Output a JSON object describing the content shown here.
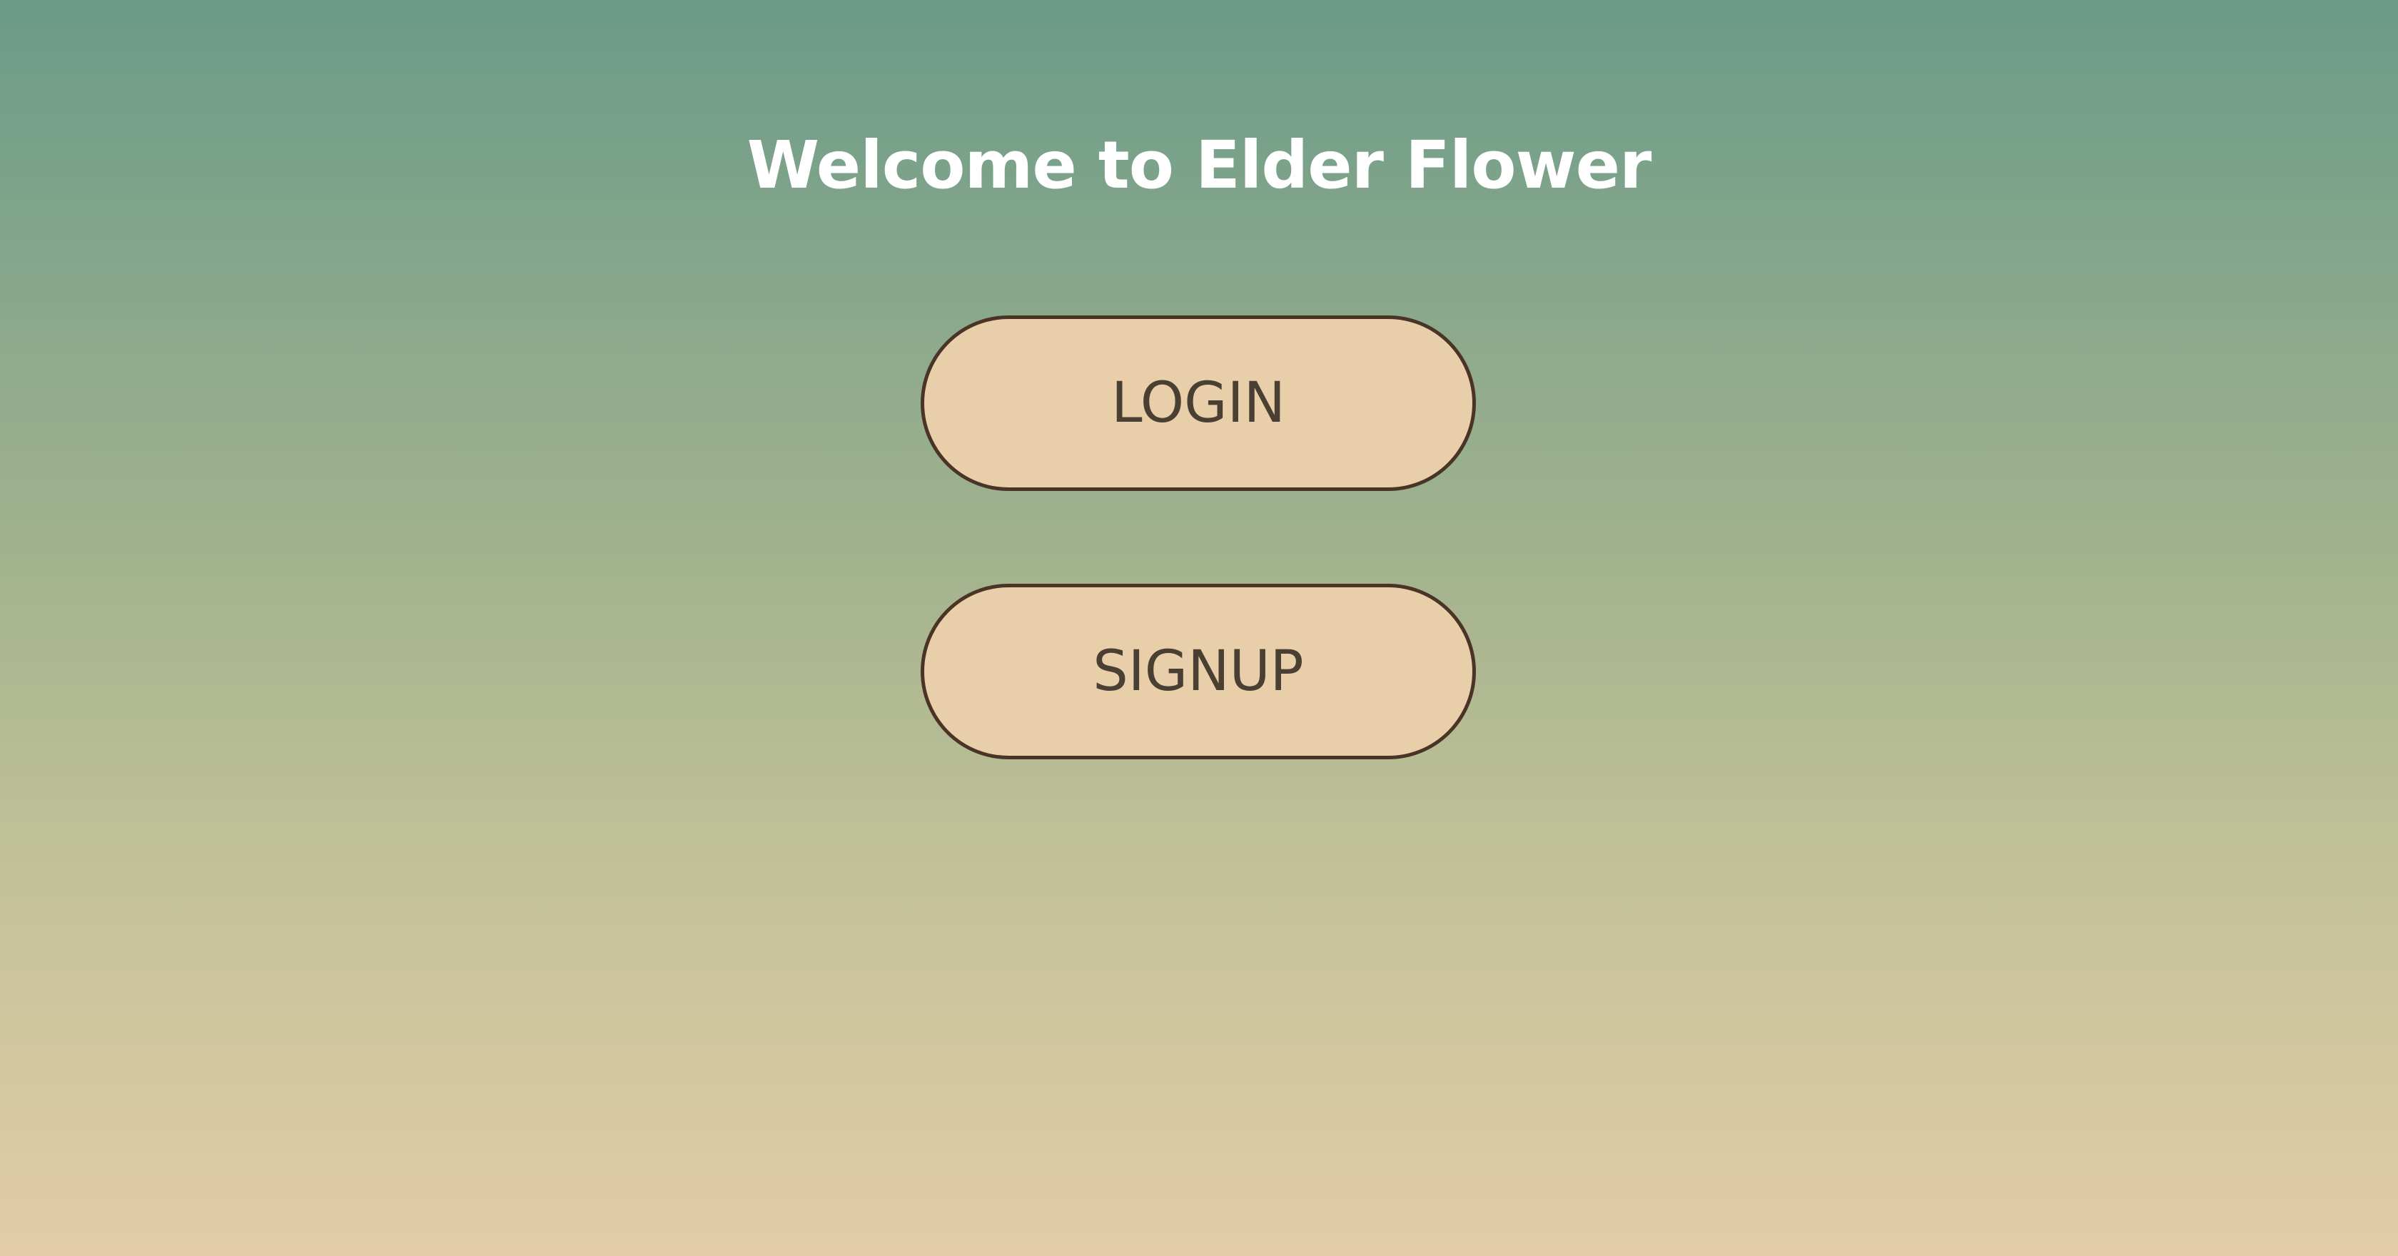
{
  "page": {
    "title": "Welcome to Elder Flower",
    "colors": {
      "gradient_top": "#6b9a89",
      "gradient_bottom": "#e3cca6",
      "button_fill": "#e8cfa9",
      "button_border": "#4a3327",
      "button_text": "#4a3f33",
      "title_text": "#ffffff"
    }
  },
  "actions": {
    "login_label": "LOGIN",
    "signup_label": "SIGNUP"
  }
}
